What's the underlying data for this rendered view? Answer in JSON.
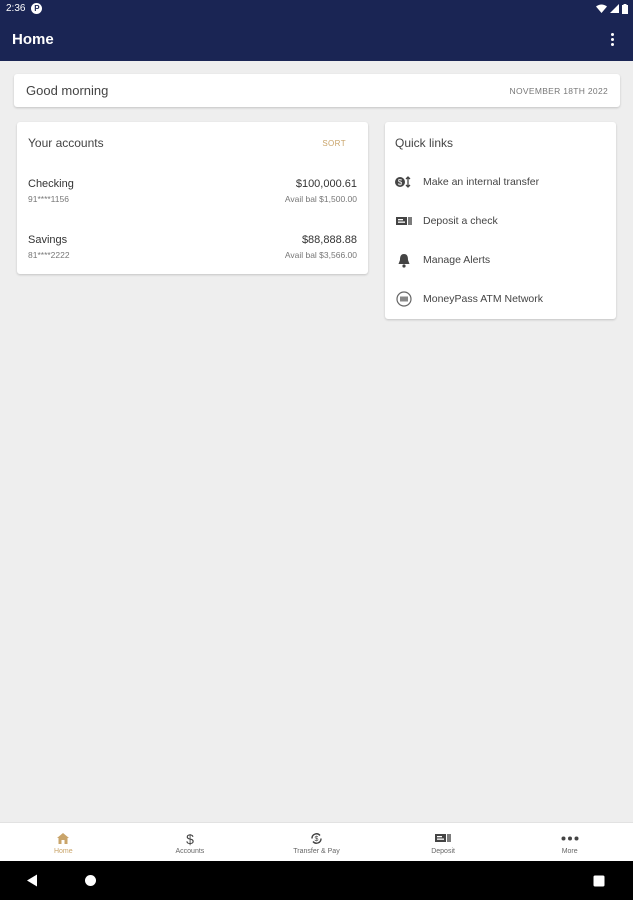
{
  "status": {
    "time": "2:36",
    "app_badge": "P"
  },
  "header": {
    "title": "Home"
  },
  "greeting": {
    "text": "Good morning",
    "date": "NOVEMBER 18TH 2022"
  },
  "accounts": {
    "title": "Your accounts",
    "sort_label": "SORT",
    "items": [
      {
        "name": "Checking",
        "number": "91****1156",
        "balance": "$100,000.61",
        "available": "Avail bal $1,500.00"
      },
      {
        "name": "Savings",
        "number": "81****2222",
        "balance": "$88,888.88",
        "available": "Avail bal $3,566.00"
      }
    ]
  },
  "quick_links": {
    "title": "Quick links",
    "items": [
      {
        "label": "Make an internal transfer",
        "icon": "transfer-icon"
      },
      {
        "label": "Deposit a check",
        "icon": "check-deposit-icon"
      },
      {
        "label": "Manage Alerts",
        "icon": "bell-icon"
      },
      {
        "label": "MoneyPass ATM Network",
        "icon": "atm-icon"
      }
    ]
  },
  "bottom_nav": {
    "items": [
      {
        "label": "Home",
        "icon": "home-icon",
        "active": true
      },
      {
        "label": "Accounts",
        "icon": "dollar-icon",
        "active": false
      },
      {
        "label": "Transfer & Pay",
        "icon": "transfer-pay-icon",
        "active": false
      },
      {
        "label": "Deposit",
        "icon": "deposit-icon",
        "active": false
      },
      {
        "label": "More",
        "icon": "more-icon",
        "active": false
      }
    ]
  },
  "colors": {
    "primary": "#1a2554",
    "accent": "#c9a46a",
    "background": "#eeeeee"
  }
}
